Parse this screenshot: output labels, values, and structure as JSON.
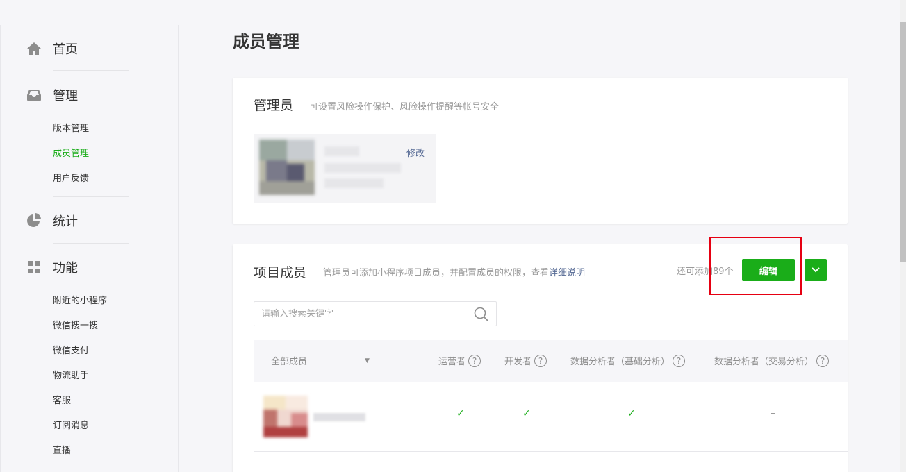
{
  "sidebar": {
    "home": {
      "label": "首页",
      "icon": "home-icon"
    },
    "manage": {
      "label": "管理",
      "icon": "inbox-icon"
    },
    "manage_items": [
      "版本管理",
      "成员管理",
      "用户反馈"
    ],
    "stats": {
      "label": "统计",
      "icon": "pie-chart-icon"
    },
    "features": {
      "label": "功能",
      "icon": "grid-icon"
    },
    "feature_items": [
      "附近的小程序",
      "微信搜一搜",
      "微信支付",
      "物流助手",
      "客服",
      "订阅消息",
      "直播"
    ],
    "active_item": "成员管理"
  },
  "page": {
    "title": "成员管理"
  },
  "admin_card": {
    "title": "管理员",
    "tip": "可设置风险操作保护、风险操作提醒等帐号安全",
    "edit_label": "修改"
  },
  "members_card": {
    "title": "项目成员",
    "tip": "管理员可添加小程序项目成员，并配置成员的权限，查看",
    "tip_link": "详细说明",
    "remain_text": "还可添加89个",
    "edit_button": "编辑",
    "search_placeholder": "请输入搜索关键字",
    "filter_label": "全部成员",
    "columns": [
      "运营者",
      "开发者",
      "数据分析者（基础分析）",
      "数据分析者（交易分析）"
    ],
    "help_glyph": "?",
    "rows": [
      {
        "values": [
          "✓",
          "✓",
          "✓",
          "–"
        ]
      }
    ]
  },
  "colors": {
    "accent": "#1aad19",
    "link": "#576b95",
    "highlight": "#e60012"
  }
}
